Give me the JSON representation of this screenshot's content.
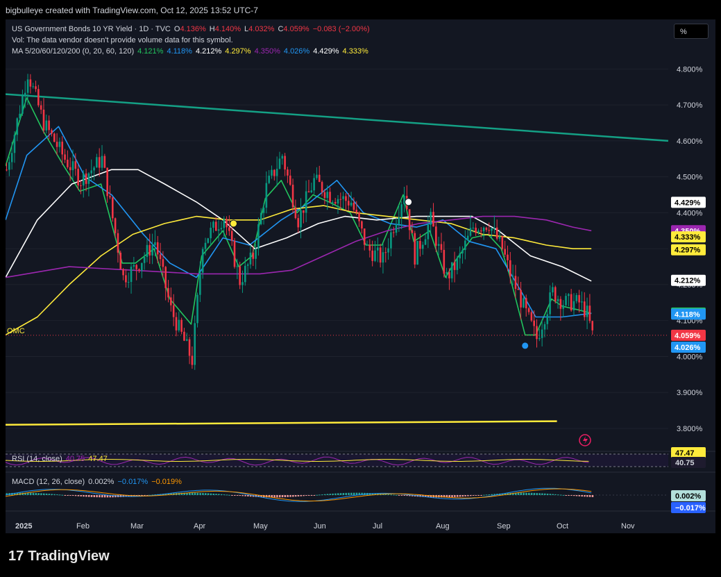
{
  "header": {
    "caption": "bigbulleye created with TradingView.com, Oct 12, 2025 13:52 UTC-7"
  },
  "legend": {
    "symbol": "US Government Bonds 10 YR Yield · 1D · TVC",
    "o_label": "O",
    "o": "4.136%",
    "h_label": "H",
    "h": "4.140%",
    "l_label": "L",
    "l": "4.032%",
    "c_label": "C",
    "c": "4.059%",
    "change": "−0.083 (−2.00%)",
    "vol": "Vol: The data vendor doesn't provide volume data for this symbol.",
    "ma_title": "MA 5/20/60/120/200 (0, 20, 60, 120)",
    "ma_values": [
      "4.121%",
      "4.118%",
      "4.212%",
      "4.297%",
      "4.350%",
      "4.026%",
      "4.429%",
      "4.333%"
    ]
  },
  "units_button": "%",
  "omc_label": "OMC",
  "rsi": {
    "title": "RSI (14, close)",
    "v1": "40.75",
    "v2": "47.47",
    "label_upper": "47.47",
    "label_lower": "40.75"
  },
  "macd": {
    "title": "MACD (12, 26, close)",
    "v1": "0.002%",
    "v2": "−0.017%",
    "v3": "−0.019%",
    "label_upper": "0.002%",
    "label_lower": "−0.017%"
  },
  "footer": {
    "brand": "TradingView"
  },
  "colors": {
    "up": "#089981",
    "down": "#f23645",
    "ma5": "#22c55e",
    "ma20": "#2196f3",
    "ma60": "#ffffff",
    "ma120": "#ffeb3b",
    "ma200": "#9c27b0",
    "trend": "#14a085"
  },
  "chart_data": {
    "type": "line",
    "y_axis": {
      "ylim": [
        3.74,
        4.88
      ],
      "ticks": [
        "4.800%",
        "4.700%",
        "4.600%",
        "4.500%",
        "4.400%",
        "4.300%",
        "4.200%",
        "4.100%",
        "4.000%",
        "3.900%",
        "3.800%"
      ],
      "tick_values": [
        4.8,
        4.7,
        4.6,
        4.5,
        4.4,
        4.3,
        4.2,
        4.1,
        4.0,
        3.9,
        3.8
      ]
    },
    "x_axis": {
      "ticks": [
        "2025",
        "Feb",
        "Mar",
        "Apr",
        "May",
        "Jun",
        "Jul",
        "Aug",
        "Sep",
        "Oct",
        "Nov"
      ]
    },
    "price_path": [
      [
        0,
        4.52
      ],
      [
        8,
        4.79
      ],
      [
        14,
        4.65
      ],
      [
        22,
        4.55
      ],
      [
        28,
        4.49
      ],
      [
        36,
        4.55
      ],
      [
        44,
        4.22
      ],
      [
        49,
        4.25
      ],
      [
        56,
        4.32
      ],
      [
        62,
        4.13
      ],
      [
        70,
        3.99
      ],
      [
        74,
        4.32
      ],
      [
        82,
        4.39
      ],
      [
        88,
        4.21
      ],
      [
        93,
        4.28
      ],
      [
        98,
        4.47
      ],
      [
        104,
        4.56
      ],
      [
        110,
        4.38
      ],
      [
        116,
        4.49
      ],
      [
        122,
        4.45
      ],
      [
        130,
        4.43
      ],
      [
        136,
        4.3
      ],
      [
        142,
        4.27
      ],
      [
        150,
        4.46
      ],
      [
        154,
        4.28
      ],
      [
        160,
        4.38
      ],
      [
        166,
        4.22
      ],
      [
        170,
        4.26
      ],
      [
        176,
        4.36
      ],
      [
        182,
        4.37
      ],
      [
        187,
        4.3
      ],
      [
        190,
        4.23
      ],
      [
        196,
        4.12
      ],
      [
        200,
        4.05
      ],
      [
        206,
        4.18
      ],
      [
        210,
        4.15
      ],
      [
        216,
        4.15
      ],
      [
        219,
        4.12
      ],
      [
        221,
        4.06
      ]
    ],
    "series": [
      {
        "name": "4.121%",
        "values": [
          [
            0,
            4.53
          ],
          [
            8,
            4.72
          ],
          [
            14,
            4.63
          ],
          [
            22,
            4.53
          ],
          [
            28,
            4.46
          ],
          [
            36,
            4.48
          ],
          [
            44,
            4.26
          ],
          [
            49,
            4.26
          ],
          [
            56,
            4.3
          ],
          [
            62,
            4.16
          ],
          [
            70,
            4.09
          ],
          [
            74,
            4.28
          ],
          [
            82,
            4.35
          ],
          [
            88,
            4.25
          ],
          [
            93,
            4.28
          ],
          [
            98,
            4.44
          ],
          [
            104,
            4.49
          ],
          [
            110,
            4.4
          ],
          [
            116,
            4.45
          ],
          [
            122,
            4.43
          ],
          [
            130,
            4.4
          ],
          [
            136,
            4.31
          ],
          [
            142,
            4.31
          ],
          [
            150,
            4.45
          ],
          [
            154,
            4.32
          ],
          [
            160,
            4.35
          ],
          [
            166,
            4.22
          ],
          [
            170,
            4.27
          ],
          [
            176,
            4.33
          ],
          [
            182,
            4.34
          ],
          [
            187,
            4.3
          ],
          [
            190,
            4.23
          ],
          [
            196,
            4.06
          ],
          [
            200,
            4.06
          ],
          [
            206,
            4.16
          ],
          [
            210,
            4.14
          ],
          [
            216,
            4.13
          ],
          [
            221,
            4.12
          ]
        ]
      },
      {
        "name": "4.118%",
        "values": [
          [
            0,
            4.38
          ],
          [
            8,
            4.56
          ],
          [
            20,
            4.64
          ],
          [
            30,
            4.5
          ],
          [
            40,
            4.45
          ],
          [
            52,
            4.34
          ],
          [
            62,
            4.26
          ],
          [
            72,
            4.22
          ],
          [
            82,
            4.33
          ],
          [
            92,
            4.31
          ],
          [
            104,
            4.38
          ],
          [
            115,
            4.43
          ],
          [
            125,
            4.49
          ],
          [
            135,
            4.4
          ],
          [
            145,
            4.37
          ],
          [
            155,
            4.36
          ],
          [
            165,
            4.38
          ],
          [
            175,
            4.32
          ],
          [
            185,
            4.3
          ],
          [
            193,
            4.2
          ],
          [
            200,
            4.11
          ],
          [
            210,
            4.11
          ],
          [
            221,
            4.12
          ]
        ]
      },
      {
        "name": "4.212%",
        "values": [
          [
            0,
            4.22
          ],
          [
            12,
            4.38
          ],
          [
            25,
            4.48
          ],
          [
            40,
            4.52
          ],
          [
            50,
            4.52
          ],
          [
            60,
            4.48
          ],
          [
            72,
            4.43
          ],
          [
            82,
            4.38
          ],
          [
            94,
            4.3
          ],
          [
            106,
            4.33
          ],
          [
            118,
            4.37
          ],
          [
            128,
            4.39
          ],
          [
            140,
            4.38
          ],
          [
            155,
            4.39
          ],
          [
            165,
            4.39
          ],
          [
            176,
            4.39
          ],
          [
            186,
            4.35
          ],
          [
            198,
            4.28
          ],
          [
            210,
            4.25
          ],
          [
            221,
            4.21
          ]
        ]
      },
      {
        "name": "4.297%",
        "values": [
          [
            0,
            4.06
          ],
          [
            12,
            4.11
          ],
          [
            24,
            4.2
          ],
          [
            36,
            4.28
          ],
          [
            48,
            4.34
          ],
          [
            60,
            4.37
          ],
          [
            72,
            4.39
          ],
          [
            84,
            4.38
          ],
          [
            96,
            4.38
          ],
          [
            108,
            4.41
          ],
          [
            120,
            4.42
          ],
          [
            132,
            4.4
          ],
          [
            144,
            4.39
          ],
          [
            156,
            4.38
          ],
          [
            168,
            4.37
          ],
          [
            180,
            4.34
          ],
          [
            192,
            4.33
          ],
          [
            204,
            4.31
          ],
          [
            214,
            4.3
          ],
          [
            221,
            4.3
          ]
        ]
      },
      {
        "name": "4.350%",
        "values": [
          [
            0,
            4.22
          ],
          [
            24,
            4.25
          ],
          [
            48,
            4.24
          ],
          [
            72,
            4.23
          ],
          [
            96,
            4.23
          ],
          [
            108,
            4.24
          ],
          [
            120,
            4.28
          ],
          [
            132,
            4.32
          ],
          [
            144,
            4.35
          ],
          [
            156,
            4.37
          ],
          [
            168,
            4.38
          ],
          [
            180,
            4.39
          ],
          [
            192,
            4.39
          ],
          [
            204,
            4.38
          ],
          [
            214,
            4.36
          ],
          [
            221,
            4.35
          ]
        ]
      },
      {
        "name": "OMC",
        "values": [
          [
            0,
            4.73
          ],
          [
            250,
            4.6
          ]
        ]
      },
      {
        "name": "",
        "values": [
          [
            0,
            3.81
          ],
          [
            208,
            3.82
          ]
        ]
      }
    ],
    "markers": [
      {
        "x": 152,
        "y": 4.43,
        "color": "#ffffff"
      },
      {
        "x": 86,
        "y": 4.37,
        "color": "#ffeb3b"
      },
      {
        "x": 196,
        "y": 4.03,
        "color": "#2196f3"
      }
    ],
    "price_labels": [
      {
        "text": "4.429%",
        "y": 4.429,
        "bg": "#ffffff",
        "fg": "#000000"
      },
      {
        "text": "4.350%",
        "y": 4.35,
        "bg": "#9c27b0",
        "fg": "#ffffff"
      },
      {
        "text": "4.333%",
        "y": 4.333,
        "bg": "#ffeb3b",
        "fg": "#000000"
      },
      {
        "text": "4.297%",
        "y": 4.297,
        "bg": "#ffeb3b",
        "fg": "#000000"
      },
      {
        "text": "4.212%",
        "y": 4.212,
        "bg": "#ffffff",
        "fg": "#000000"
      },
      {
        "text": "4.121%",
        "y": 4.121,
        "bg": "#22c55e",
        "fg": "#000000"
      },
      {
        "text": "4.118%",
        "y": 4.118,
        "bg": "#2196f3",
        "fg": "#ffffff"
      },
      {
        "text": "4.059%",
        "y": 4.059,
        "bg": "#f23645",
        "fg": "#ffffff"
      },
      {
        "text": "4.026%",
        "y": 4.026,
        "bg": "#2196f3",
        "fg": "#ffffff"
      }
    ]
  }
}
